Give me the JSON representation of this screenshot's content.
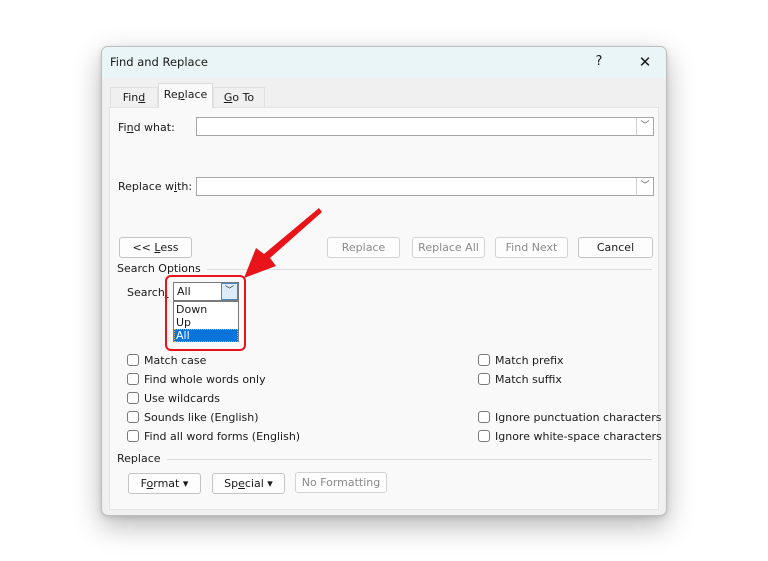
{
  "window": {
    "title": "Find and Replace",
    "help_label": "?",
    "close_label": "✕"
  },
  "tabs": [
    {
      "pre": "Fin",
      "u": "d",
      "post": "",
      "active": false
    },
    {
      "pre": "Re",
      "u": "p",
      "post": "lace",
      "active": true
    },
    {
      "pre": "",
      "u": "G",
      "post": "o To",
      "active": false
    }
  ],
  "fields": {
    "find_what": {
      "label_pre": "Fi",
      "label_u": "n",
      "label_post": "d what:",
      "value": ""
    },
    "replace_with": {
      "label_pre": "Replace w",
      "label_u": "i",
      "label_post": "th:",
      "value": ""
    },
    "dropdown_icon": "chevron-down"
  },
  "buttons": {
    "less": {
      "pre": "<< ",
      "u": "L",
      "post": "ess"
    },
    "replace": "Replace",
    "replace_all": "Replace All",
    "find_next": "Find Next",
    "cancel": "Cancel"
  },
  "search_options": {
    "heading": "Search Options",
    "search_label_pre": "Search",
    "search_label_u": ":",
    "search_value": "All",
    "search_options_list": [
      "Down",
      "Up",
      "All"
    ],
    "selected_option": "All",
    "left_checkboxes": [
      {
        "label": "Match case",
        "checked": false
      },
      {
        "label": "Find whole words only",
        "checked": false
      },
      {
        "label": "Use wildcards",
        "checked": false
      },
      {
        "label": "Sounds like (English)",
        "checked": false
      },
      {
        "label": "Find all word forms (English)",
        "checked": false
      }
    ],
    "right_checkboxes": [
      {
        "label": "Match prefix",
        "checked": false
      },
      {
        "label": "Match suffix",
        "checked": false
      },
      {
        "label": "Ignore punctuation characters",
        "checked": false
      },
      {
        "label": "Ignore white-space characters",
        "checked": false
      }
    ]
  },
  "replace_section": {
    "heading": "Replace",
    "format": {
      "pre": "F",
      "u": "o",
      "post": "rmat ▾"
    },
    "special": {
      "pre": "Sp",
      "u": "e",
      "post": "cial ▾"
    },
    "no_formatting": "No Formatting"
  },
  "annotation": {
    "color": "#e8141a",
    "target": "search-direction-dropdown"
  }
}
